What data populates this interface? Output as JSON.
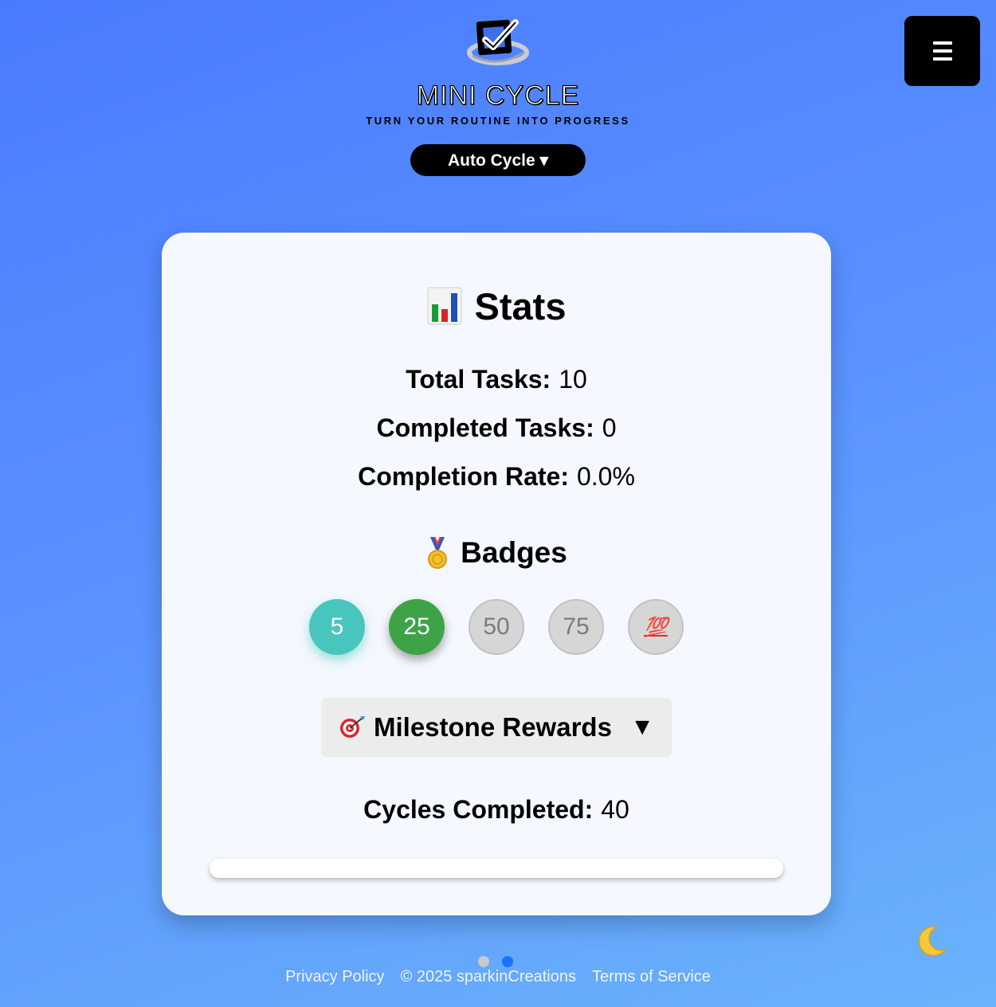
{
  "header": {
    "app_title": "MINI CYCLE",
    "tagline": "TURN YOUR ROUTINE INTO PROGRESS",
    "mode_button": "Auto Cycle ▾",
    "logo_icon": "checkbox-check-icon",
    "menu_icon": "hamburger-menu-icon"
  },
  "stats": {
    "heading_icon": "📊",
    "heading": "Stats",
    "total_label": "Total Tasks:",
    "total_value": "10",
    "completed_label": "Completed Tasks:",
    "completed_value": "0",
    "rate_label": "Completion Rate:",
    "rate_value": "0.0%"
  },
  "badges": {
    "heading_icon": "🏅",
    "heading": "Badges",
    "items": [
      {
        "label": "5",
        "state": "earned",
        "color": "#48c6bd"
      },
      {
        "label": "25",
        "state": "earned",
        "color": "#3ea347"
      },
      {
        "label": "50",
        "state": "locked"
      },
      {
        "label": "75",
        "state": "locked"
      },
      {
        "label": "💯",
        "state": "locked"
      }
    ]
  },
  "milestones": {
    "icon": "🎯",
    "label": "Milestone Rewards",
    "arrow": "▼"
  },
  "cycles": {
    "label": "Cycles Completed:",
    "value": "40",
    "progress_fraction": 0
  },
  "theme_toggle_icon": "moon-icon",
  "page_dots": {
    "count": 2,
    "active_index": 1
  },
  "footer": {
    "privacy": "Privacy Policy",
    "copyright": "© 2025 sparkinCreations",
    "terms": "Terms of Service"
  },
  "colors": {
    "background_start": "#4a7bff",
    "background_end": "#6ab3fb",
    "panel": "#f5f8fe",
    "accent_dot": "#1a73ff"
  }
}
